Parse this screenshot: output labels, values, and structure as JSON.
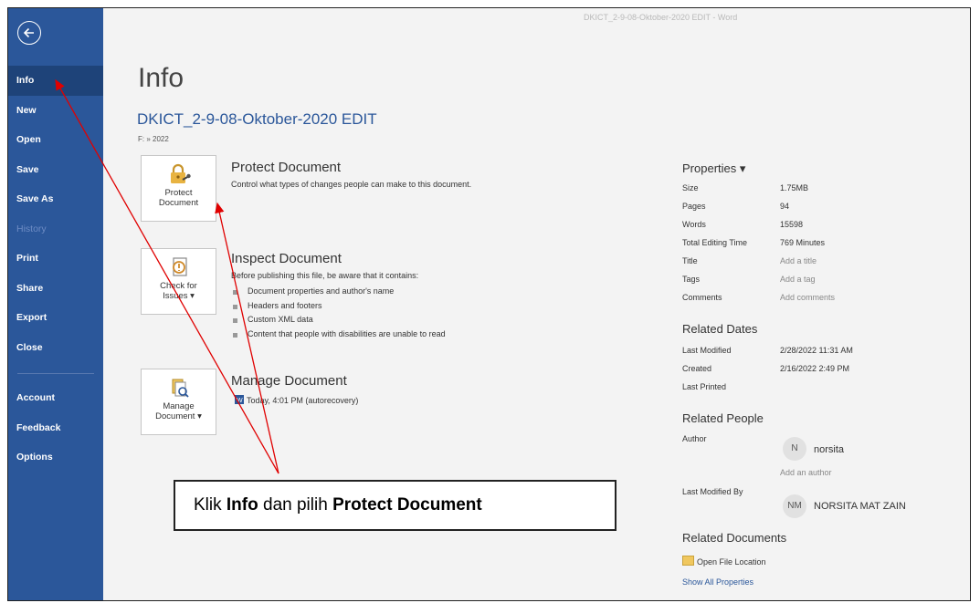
{
  "window_title": "DKICT_2-9-08-Oktober-2020 EDIT  -  Word",
  "sidebar": {
    "items": [
      {
        "label": "Info",
        "state": "active"
      },
      {
        "label": "New",
        "state": "normal"
      },
      {
        "label": "Open",
        "state": "normal"
      },
      {
        "label": "Save",
        "state": "normal"
      },
      {
        "label": "Save As",
        "state": "normal"
      },
      {
        "label": "History",
        "state": "disabled"
      },
      {
        "label": "Print",
        "state": "normal"
      },
      {
        "label": "Share",
        "state": "normal"
      },
      {
        "label": "Export",
        "state": "normal"
      },
      {
        "label": "Close",
        "state": "normal"
      }
    ],
    "bottom_items": [
      {
        "label": "Account"
      },
      {
        "label": "Feedback"
      },
      {
        "label": "Options"
      }
    ]
  },
  "main": {
    "title": "Info",
    "doc_title": "DKICT_2-9-08-Oktober-2020 EDIT",
    "doc_path": "F: » 2022",
    "protect": {
      "tile_line1": "Protect",
      "tile_line2": "Document",
      "heading": "Protect Document",
      "description": "Control what types of changes people can make to this document."
    },
    "inspect": {
      "tile_line1": "Check for",
      "tile_line2": "Issues ▾",
      "heading": "Inspect Document",
      "description": "Before publishing this file, be aware that it contains:",
      "bullets": [
        "Document properties and author's name",
        "Headers and footers",
        "Custom XML data",
        "Content that people with disabilities are unable to read"
      ]
    },
    "manage": {
      "tile_line1": "Manage",
      "tile_line2": "Document ▾",
      "heading": "Manage Document",
      "entry": "Today, 4:01 PM (autorecovery)"
    }
  },
  "properties": {
    "heading": "Properties ▾",
    "rows": [
      {
        "label": "Size",
        "value": "1.75MB"
      },
      {
        "label": "Pages",
        "value": "94"
      },
      {
        "label": "Words",
        "value": "15598"
      },
      {
        "label": "Total Editing Time",
        "value": "769 Minutes"
      },
      {
        "label": "Title",
        "value": "Add a title"
      },
      {
        "label": "Tags",
        "value": "Add a tag"
      },
      {
        "label": "Comments",
        "value": "Add comments"
      }
    ],
    "related_dates_heading": "Related Dates",
    "dates": [
      {
        "label": "Last Modified",
        "value": "2/28/2022 11:31 AM"
      },
      {
        "label": "Created",
        "value": "2/16/2022 2:49 PM"
      },
      {
        "label": "Last Printed",
        "value": ""
      }
    ],
    "related_people_heading": "Related People",
    "author_label": "Author",
    "author_initial": "N",
    "author_name": "norsita",
    "add_author": "Add an author",
    "last_modified_by_label": "Last Modified By",
    "modifier_initials": "NM",
    "modifier_name": "NORSITA MAT ZAIN",
    "related_docs_heading": "Related Documents",
    "open_file_location": "Open File Location",
    "show_all": "Show All Properties"
  },
  "callout": {
    "prefix": "Klik ",
    "bold1": "Info",
    "middle": " dan pilih ",
    "bold2": "Protect Document"
  },
  "colors": {
    "sidebar": "#2b579a",
    "sidebar_active": "#1e4379",
    "annotation_arrow": "#e00000",
    "doc_title": "#2b579a"
  }
}
